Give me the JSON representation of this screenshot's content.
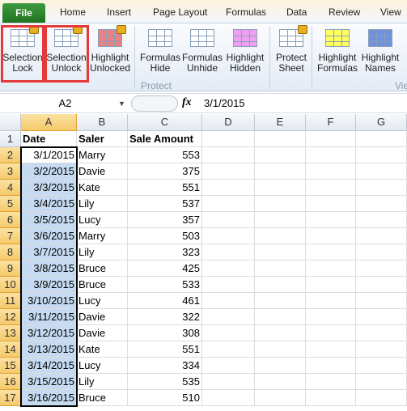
{
  "tabs": [
    "File",
    "Home",
    "Insert",
    "Page Layout",
    "Formulas",
    "Data",
    "Review",
    "View"
  ],
  "ribbon": {
    "buttons": [
      {
        "l1": "Selection",
        "l2": "Lock",
        "icon": "selection-lock-icon"
      },
      {
        "l1": "Selection",
        "l2": "Unlock",
        "icon": "selection-unlock-icon"
      },
      {
        "l1": "Highlight",
        "l2": "Unlocked",
        "icon": "highlight-unlocked-icon"
      },
      {
        "l1": "Formulas",
        "l2": "Hide",
        "icon": "formulas-hide-icon"
      },
      {
        "l1": "Formulas",
        "l2": "Unhide",
        "icon": "formulas-unhide-icon"
      },
      {
        "l1": "Highlight",
        "l2": "Hidden",
        "icon": "highlight-hidden-icon"
      },
      {
        "l1": "Protect",
        "l2": "Sheet",
        "icon": "protect-sheet-icon"
      },
      {
        "l1": "Highlight",
        "l2": "Formulas",
        "icon": "highlight-formulas-icon"
      },
      {
        "l1": "Highlight",
        "l2": "Names",
        "icon": "highlight-names-icon"
      }
    ],
    "group_protect": "Protect",
    "group_view": "Vie"
  },
  "formula_bar": {
    "name_box": "A2",
    "fx": "fx",
    "value": "3/1/2015"
  },
  "columns": [
    "A",
    "B",
    "C",
    "D",
    "E",
    "F",
    "G"
  ],
  "header": [
    "Date",
    "Saler",
    "Sale Amount"
  ],
  "rows": [
    [
      "3/1/2015",
      "Marry",
      "553"
    ],
    [
      "3/2/2015",
      "Davie",
      "375"
    ],
    [
      "3/3/2015",
      "Kate",
      "551"
    ],
    [
      "3/4/2015",
      "Lily",
      "537"
    ],
    [
      "3/5/2015",
      "Lucy",
      "357"
    ],
    [
      "3/6/2015",
      "Marry",
      "503"
    ],
    [
      "3/7/2015",
      "Lily",
      "323"
    ],
    [
      "3/8/2015",
      "Bruce",
      "425"
    ],
    [
      "3/9/2015",
      "Bruce",
      "533"
    ],
    [
      "3/10/2015",
      "Lucy",
      "461"
    ],
    [
      "3/11/2015",
      "Davie",
      "322"
    ],
    [
      "3/12/2015",
      "Davie",
      "308"
    ],
    [
      "3/13/2015",
      "Kate",
      "551"
    ],
    [
      "3/14/2015",
      "Lucy",
      "334"
    ],
    [
      "3/15/2015",
      "Lily",
      "535"
    ],
    [
      "3/16/2015",
      "Bruce",
      "510"
    ]
  ]
}
